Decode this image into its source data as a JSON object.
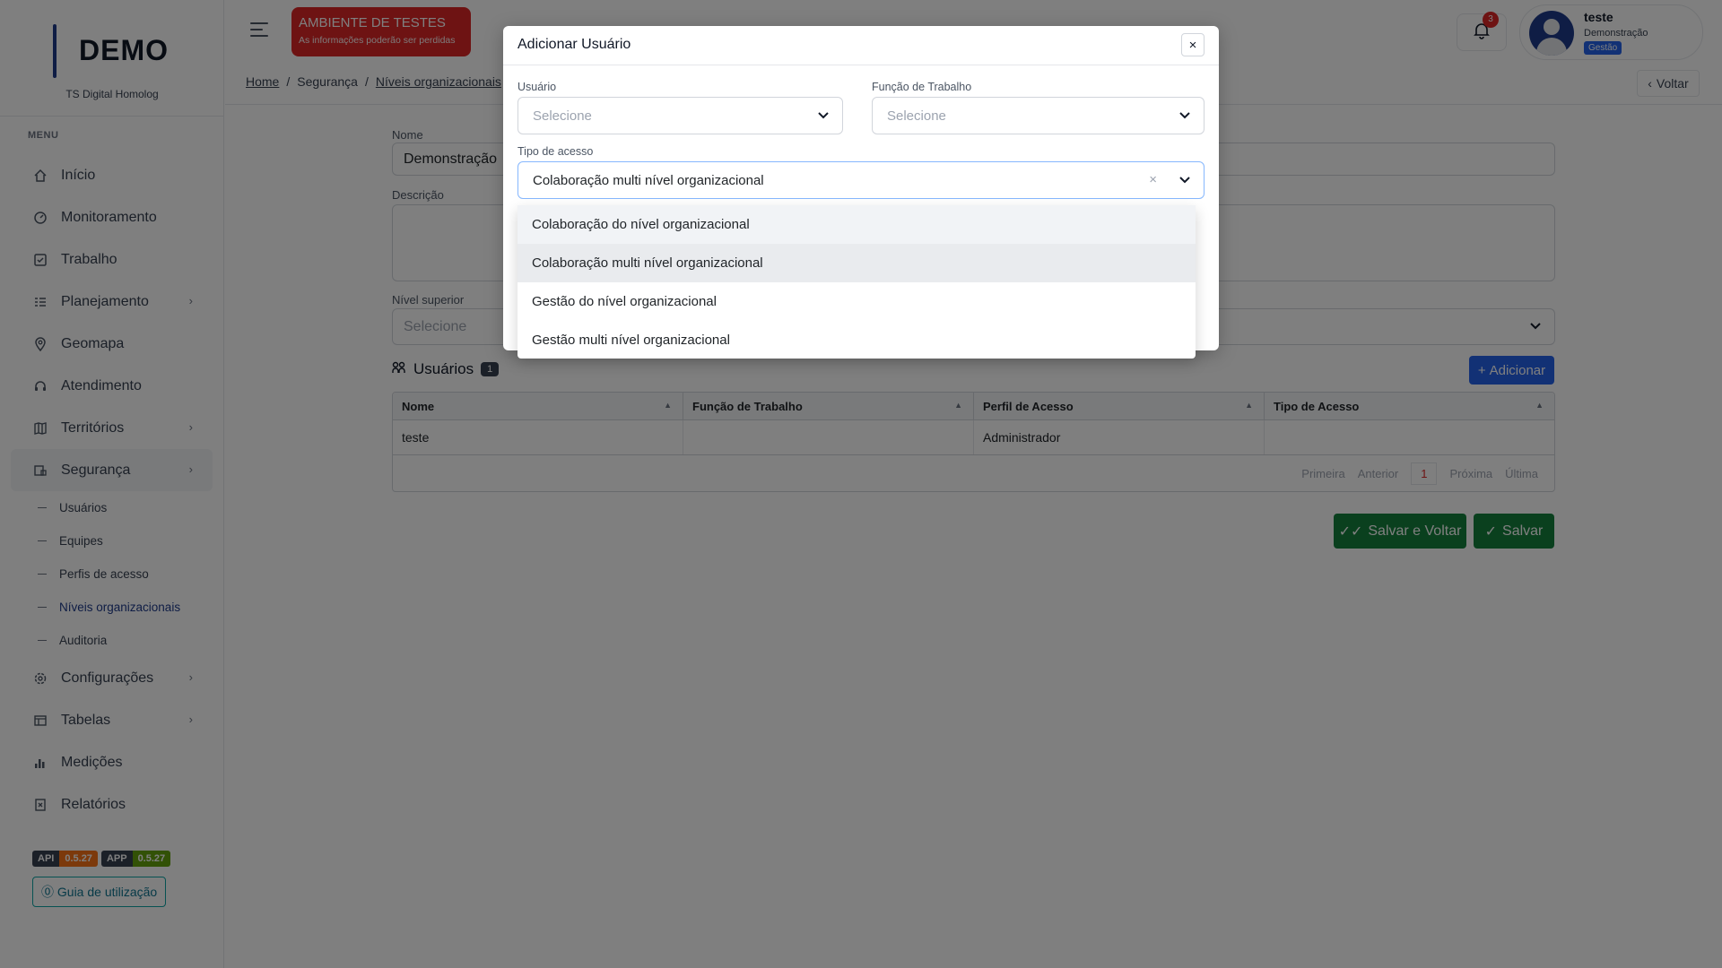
{
  "sidebar": {
    "logo": "DEMO",
    "subtitle": "TS Digital Homolog",
    "menu_label": "MENU",
    "items": [
      {
        "label": "Início"
      },
      {
        "label": "Monitoramento"
      },
      {
        "label": "Trabalho"
      },
      {
        "label": "Planejamento"
      },
      {
        "label": "Geomapa"
      },
      {
        "label": "Atendimento"
      },
      {
        "label": "Territórios"
      },
      {
        "label": "Segurança"
      },
      {
        "label": "Configurações"
      },
      {
        "label": "Tabelas"
      },
      {
        "label": "Medições"
      },
      {
        "label": "Relatórios"
      }
    ],
    "sub_items": [
      {
        "label": "Usuários"
      },
      {
        "label": "Equipes"
      },
      {
        "label": "Perfis de acesso"
      },
      {
        "label": "Níveis organizacionais"
      },
      {
        "label": "Auditoria"
      }
    ],
    "versions": {
      "api_key": "API",
      "api_val": "0.5.27",
      "app_key": "APP",
      "app_val": "0.5.27"
    },
    "guide": "Guia de utilização"
  },
  "header": {
    "env_title": "AMBIENTE DE TESTES",
    "env_sub": "As informações poderão ser perdidas",
    "breadcrumb": [
      "Home",
      "Segurança",
      "Níveis organizacionais"
    ],
    "notif_count": "3",
    "user_name": "teste",
    "user_org": "Demonstração",
    "user_role": "Gestão",
    "back": "Voltar"
  },
  "form": {
    "nome_label": "Nome",
    "nome_value": "Demonstração",
    "descricao_label": "Descrição",
    "nivel_label": "Nível superior",
    "nivel_placeholder": "Selecione"
  },
  "users": {
    "title": "Usuários",
    "count": "1",
    "add": "Adicionar",
    "columns": [
      "Nome",
      "Função de Trabalho",
      "Perfil de Acesso",
      "Tipo de Acesso"
    ],
    "rows": [
      [
        "teste",
        "",
        "Administrador",
        ""
      ]
    ],
    "pager": {
      "first": "Primeira",
      "prev": "Anterior",
      "current": "1",
      "next": "Próxima",
      "last": "Última"
    }
  },
  "buttons": {
    "save_back": "Salvar e Voltar",
    "save": "Salvar"
  },
  "modal": {
    "title": "Adicionar Usuário",
    "close": "×",
    "usuario_label": "Usuário",
    "usuario_placeholder": "Selecione",
    "funcao_label": "Função de Trabalho",
    "funcao_placeholder": "Selecione",
    "tipo_label": "Tipo de acesso",
    "tipo_value": "Colaboração multi nível organizacional",
    "options": [
      "Colaboração do nível organizacional",
      "Colaboração multi nível organizacional",
      "Gestão do nível organizacional",
      "Gestão multi nível organizacional"
    ]
  },
  "colors": {
    "primary": "#2563eb",
    "success": "#15803d",
    "danger": "#dc2626",
    "navy": "#1e3a8a"
  }
}
